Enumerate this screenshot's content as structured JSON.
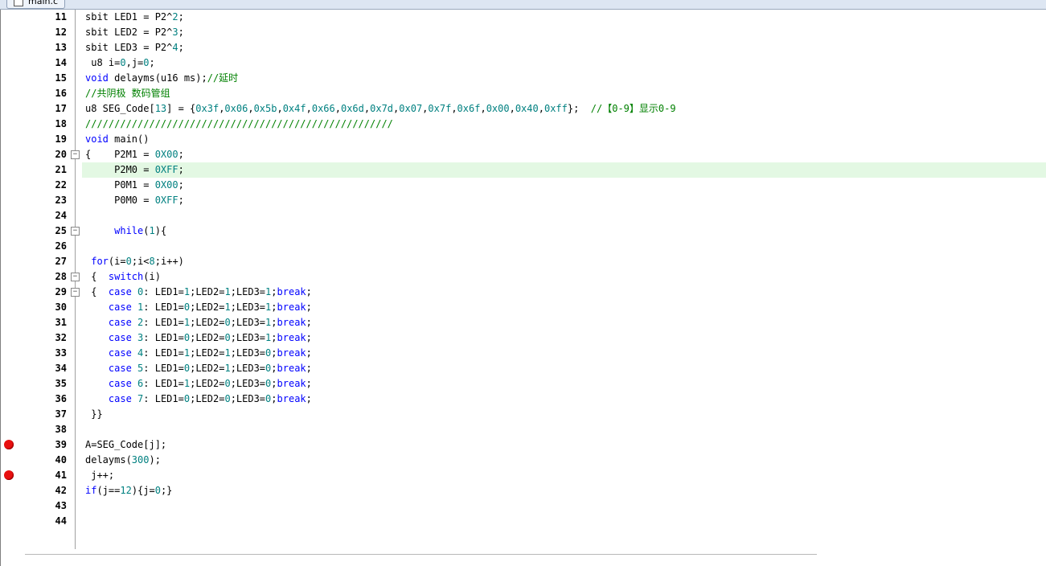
{
  "tab": {
    "label": "main.c"
  },
  "editor": {
    "lines": [
      {
        "num": "11",
        "tokens": [
          {
            "t": "sbit LED1 = P2^",
            "c": "tx"
          },
          {
            "t": "2",
            "c": "num"
          },
          {
            "t": ";",
            "c": "tx"
          }
        ]
      },
      {
        "num": "12",
        "tokens": [
          {
            "t": "sbit LED2 = P2^",
            "c": "tx"
          },
          {
            "t": "3",
            "c": "num"
          },
          {
            "t": ";",
            "c": "tx"
          }
        ]
      },
      {
        "num": "13",
        "tokens": [
          {
            "t": "sbit LED3 = P2^",
            "c": "tx"
          },
          {
            "t": "4",
            "c": "num"
          },
          {
            "t": ";",
            "c": "tx"
          }
        ]
      },
      {
        "num": "14",
        "tokens": [
          {
            "t": " u8 i=",
            "c": "tx"
          },
          {
            "t": "0",
            "c": "num"
          },
          {
            "t": ",j=",
            "c": "tx"
          },
          {
            "t": "0",
            "c": "num"
          },
          {
            "t": ";",
            "c": "tx"
          }
        ]
      },
      {
        "num": "15",
        "tokens": [
          {
            "t": "void",
            "c": "kw"
          },
          {
            "t": " delayms(u16 ms);",
            "c": "tx"
          },
          {
            "t": "//延时",
            "c": "cm"
          }
        ]
      },
      {
        "num": "16",
        "tokens": [
          {
            "t": "//共阴极 数码管组",
            "c": "cm"
          }
        ]
      },
      {
        "num": "17",
        "tokens": [
          {
            "t": "u8 SEG_Code[",
            "c": "tx"
          },
          {
            "t": "13",
            "c": "num"
          },
          {
            "t": "] = {",
            "c": "tx"
          },
          {
            "t": "0x3f",
            "c": "num"
          },
          {
            "t": ",",
            "c": "tx"
          },
          {
            "t": "0x06",
            "c": "num"
          },
          {
            "t": ",",
            "c": "tx"
          },
          {
            "t": "0x5b",
            "c": "num"
          },
          {
            "t": ",",
            "c": "tx"
          },
          {
            "t": "0x4f",
            "c": "num"
          },
          {
            "t": ",",
            "c": "tx"
          },
          {
            "t": "0x66",
            "c": "num"
          },
          {
            "t": ",",
            "c": "tx"
          },
          {
            "t": "0x6d",
            "c": "num"
          },
          {
            "t": ",",
            "c": "tx"
          },
          {
            "t": "0x7d",
            "c": "num"
          },
          {
            "t": ",",
            "c": "tx"
          },
          {
            "t": "0x07",
            "c": "num"
          },
          {
            "t": ",",
            "c": "tx"
          },
          {
            "t": "0x7f",
            "c": "num"
          },
          {
            "t": ",",
            "c": "tx"
          },
          {
            "t": "0x6f",
            "c": "num"
          },
          {
            "t": ",",
            "c": "tx"
          },
          {
            "t": "0x00",
            "c": "num"
          },
          {
            "t": ",",
            "c": "tx"
          },
          {
            "t": "0x40",
            "c": "num"
          },
          {
            "t": ",",
            "c": "tx"
          },
          {
            "t": "0xff",
            "c": "num"
          },
          {
            "t": "};  ",
            "c": "tx"
          },
          {
            "t": "//【0-9】显示0-9",
            "c": "cm"
          }
        ]
      },
      {
        "num": "18",
        "tokens": [
          {
            "t": "/////////////////////////////////////////////////////",
            "c": "cm"
          }
        ]
      },
      {
        "num": "19",
        "tokens": [
          {
            "t": "void",
            "c": "kw"
          },
          {
            "t": " main()",
            "c": "tx"
          }
        ]
      },
      {
        "num": "20",
        "fold": "−",
        "tokens": [
          {
            "t": "{    P2M1 = ",
            "c": "tx"
          },
          {
            "t": "0X00",
            "c": "num"
          },
          {
            "t": ";",
            "c": "tx"
          }
        ]
      },
      {
        "num": "21",
        "hl": true,
        "tokens": [
          {
            "t": "     P2M0 = ",
            "c": "tx"
          },
          {
            "t": "0XFF",
            "c": "num"
          },
          {
            "t": ";",
            "c": "tx"
          }
        ]
      },
      {
        "num": "22",
        "tokens": [
          {
            "t": "     P0M1 = ",
            "c": "tx"
          },
          {
            "t": "0X00",
            "c": "num"
          },
          {
            "t": ";",
            "c": "tx"
          }
        ]
      },
      {
        "num": "23",
        "tokens": [
          {
            "t": "     P0M0 = ",
            "c": "tx"
          },
          {
            "t": "0XFF",
            "c": "num"
          },
          {
            "t": ";",
            "c": "tx"
          }
        ]
      },
      {
        "num": "24",
        "tokens": []
      },
      {
        "num": "25",
        "fold": "−",
        "tokens": [
          {
            "t": "     ",
            "c": "tx"
          },
          {
            "t": "while",
            "c": "kw"
          },
          {
            "t": "(",
            "c": "tx"
          },
          {
            "t": "1",
            "c": "num"
          },
          {
            "t": "){",
            "c": "tx"
          }
        ]
      },
      {
        "num": "26",
        "tokens": []
      },
      {
        "num": "27",
        "tokens": [
          {
            "t": " ",
            "c": "tx"
          },
          {
            "t": "for",
            "c": "kw"
          },
          {
            "t": "(i=",
            "c": "tx"
          },
          {
            "t": "0",
            "c": "num"
          },
          {
            "t": ";i<",
            "c": "tx"
          },
          {
            "t": "8",
            "c": "num"
          },
          {
            "t": ";i++)",
            "c": "tx"
          }
        ]
      },
      {
        "num": "28",
        "fold": "−",
        "tokens": [
          {
            "t": " {  ",
            "c": "tx"
          },
          {
            "t": "switch",
            "c": "kw"
          },
          {
            "t": "(i)",
            "c": "tx"
          }
        ]
      },
      {
        "num": "29",
        "fold": "−",
        "tokens": [
          {
            "t": " {  ",
            "c": "tx"
          },
          {
            "t": "case",
            "c": "kw"
          },
          {
            "t": " ",
            "c": "tx"
          },
          {
            "t": "0",
            "c": "num"
          },
          {
            "t": ": LED1=",
            "c": "tx"
          },
          {
            "t": "1",
            "c": "num"
          },
          {
            "t": ";LED2=",
            "c": "tx"
          },
          {
            "t": "1",
            "c": "num"
          },
          {
            "t": ";LED3=",
            "c": "tx"
          },
          {
            "t": "1",
            "c": "num"
          },
          {
            "t": ";",
            "c": "tx"
          },
          {
            "t": "break",
            "c": "kw"
          },
          {
            "t": ";",
            "c": "tx"
          }
        ]
      },
      {
        "num": "30",
        "tokens": [
          {
            "t": "    ",
            "c": "tx"
          },
          {
            "t": "case",
            "c": "kw"
          },
          {
            "t": " ",
            "c": "tx"
          },
          {
            "t": "1",
            "c": "num"
          },
          {
            "t": ": LED1=",
            "c": "tx"
          },
          {
            "t": "0",
            "c": "num"
          },
          {
            "t": ";LED2=",
            "c": "tx"
          },
          {
            "t": "1",
            "c": "num"
          },
          {
            "t": ";LED3=",
            "c": "tx"
          },
          {
            "t": "1",
            "c": "num"
          },
          {
            "t": ";",
            "c": "tx"
          },
          {
            "t": "break",
            "c": "kw"
          },
          {
            "t": ";",
            "c": "tx"
          }
        ]
      },
      {
        "num": "31",
        "tokens": [
          {
            "t": "    ",
            "c": "tx"
          },
          {
            "t": "case",
            "c": "kw"
          },
          {
            "t": " ",
            "c": "tx"
          },
          {
            "t": "2",
            "c": "num"
          },
          {
            "t": ": LED1=",
            "c": "tx"
          },
          {
            "t": "1",
            "c": "num"
          },
          {
            "t": ";LED2=",
            "c": "tx"
          },
          {
            "t": "0",
            "c": "num"
          },
          {
            "t": ";LED3=",
            "c": "tx"
          },
          {
            "t": "1",
            "c": "num"
          },
          {
            "t": ";",
            "c": "tx"
          },
          {
            "t": "break",
            "c": "kw"
          },
          {
            "t": ";",
            "c": "tx"
          }
        ]
      },
      {
        "num": "32",
        "tokens": [
          {
            "t": "    ",
            "c": "tx"
          },
          {
            "t": "case",
            "c": "kw"
          },
          {
            "t": " ",
            "c": "tx"
          },
          {
            "t": "3",
            "c": "num"
          },
          {
            "t": ": LED1=",
            "c": "tx"
          },
          {
            "t": "0",
            "c": "num"
          },
          {
            "t": ";LED2=",
            "c": "tx"
          },
          {
            "t": "0",
            "c": "num"
          },
          {
            "t": ";LED3=",
            "c": "tx"
          },
          {
            "t": "1",
            "c": "num"
          },
          {
            "t": ";",
            "c": "tx"
          },
          {
            "t": "break",
            "c": "kw"
          },
          {
            "t": ";",
            "c": "tx"
          }
        ]
      },
      {
        "num": "33",
        "tokens": [
          {
            "t": "    ",
            "c": "tx"
          },
          {
            "t": "case",
            "c": "kw"
          },
          {
            "t": " ",
            "c": "tx"
          },
          {
            "t": "4",
            "c": "num"
          },
          {
            "t": ": LED1=",
            "c": "tx"
          },
          {
            "t": "1",
            "c": "num"
          },
          {
            "t": ";LED2=",
            "c": "tx"
          },
          {
            "t": "1",
            "c": "num"
          },
          {
            "t": ";LED3=",
            "c": "tx"
          },
          {
            "t": "0",
            "c": "num"
          },
          {
            "t": ";",
            "c": "tx"
          },
          {
            "t": "break",
            "c": "kw"
          },
          {
            "t": ";",
            "c": "tx"
          }
        ]
      },
      {
        "num": "34",
        "tokens": [
          {
            "t": "    ",
            "c": "tx"
          },
          {
            "t": "case",
            "c": "kw"
          },
          {
            "t": " ",
            "c": "tx"
          },
          {
            "t": "5",
            "c": "num"
          },
          {
            "t": ": LED1=",
            "c": "tx"
          },
          {
            "t": "0",
            "c": "num"
          },
          {
            "t": ";LED2=",
            "c": "tx"
          },
          {
            "t": "1",
            "c": "num"
          },
          {
            "t": ";LED3=",
            "c": "tx"
          },
          {
            "t": "0",
            "c": "num"
          },
          {
            "t": ";",
            "c": "tx"
          },
          {
            "t": "break",
            "c": "kw"
          },
          {
            "t": ";",
            "c": "tx"
          }
        ]
      },
      {
        "num": "35",
        "tokens": [
          {
            "t": "    ",
            "c": "tx"
          },
          {
            "t": "case",
            "c": "kw"
          },
          {
            "t": " ",
            "c": "tx"
          },
          {
            "t": "6",
            "c": "num"
          },
          {
            "t": ": LED1=",
            "c": "tx"
          },
          {
            "t": "1",
            "c": "num"
          },
          {
            "t": ";LED2=",
            "c": "tx"
          },
          {
            "t": "0",
            "c": "num"
          },
          {
            "t": ";LED3=",
            "c": "tx"
          },
          {
            "t": "0",
            "c": "num"
          },
          {
            "t": ";",
            "c": "tx"
          },
          {
            "t": "break",
            "c": "kw"
          },
          {
            "t": ";",
            "c": "tx"
          }
        ]
      },
      {
        "num": "36",
        "tokens": [
          {
            "t": "    ",
            "c": "tx"
          },
          {
            "t": "case",
            "c": "kw"
          },
          {
            "t": " ",
            "c": "tx"
          },
          {
            "t": "7",
            "c": "num"
          },
          {
            "t": ": LED1=",
            "c": "tx"
          },
          {
            "t": "0",
            "c": "num"
          },
          {
            "t": ";LED2=",
            "c": "tx"
          },
          {
            "t": "0",
            "c": "num"
          },
          {
            "t": ";LED3=",
            "c": "tx"
          },
          {
            "t": "0",
            "c": "num"
          },
          {
            "t": ";",
            "c": "tx"
          },
          {
            "t": "break",
            "c": "kw"
          },
          {
            "t": ";",
            "c": "tx"
          }
        ]
      },
      {
        "num": "37",
        "tokens": [
          {
            "t": " }}",
            "c": "tx"
          }
        ]
      },
      {
        "num": "38",
        "tokens": []
      },
      {
        "num": "39",
        "bp": true,
        "tokens": [
          {
            "t": "A=SEG_Code[j];",
            "c": "tx"
          }
        ]
      },
      {
        "num": "40",
        "tokens": [
          {
            "t": "delayms(",
            "c": "tx"
          },
          {
            "t": "300",
            "c": "num"
          },
          {
            "t": ");",
            "c": "tx"
          }
        ]
      },
      {
        "num": "41",
        "bp": true,
        "tokens": [
          {
            "t": " j++;",
            "c": "tx"
          }
        ]
      },
      {
        "num": "42",
        "tokens": [
          {
            "t": "if",
            "c": "kw"
          },
          {
            "t": "(j==",
            "c": "tx"
          },
          {
            "t": "12",
            "c": "num"
          },
          {
            "t": "){j=",
            "c": "tx"
          },
          {
            "t": "0",
            "c": "num"
          },
          {
            "t": ";}",
            "c": "tx"
          }
        ]
      },
      {
        "num": "43",
        "tokens": []
      },
      {
        "num": "44",
        "tokens": []
      }
    ]
  },
  "colors": {
    "keyword": "#0000ff",
    "number": "#008080",
    "comment": "#008000",
    "highlight": "#e3f8e3",
    "breakpoint": "#e81010"
  }
}
